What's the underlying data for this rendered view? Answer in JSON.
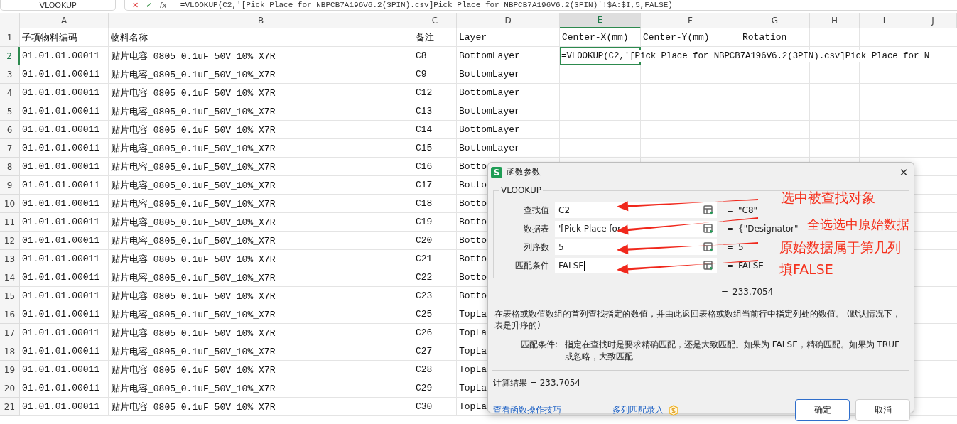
{
  "name_box": "VLOOKUP",
  "formula_bar": {
    "cancel": "✕",
    "confirm": "✓",
    "fx": "fx",
    "formula": "=VLOOKUP(C2,'[Pick Place for NBPCB7A196V6.2(3PIN).csv]Pick Place for NBPCB7A196V6.2(3PIN)'!$A:$I,5,FALSE)"
  },
  "columns": [
    {
      "label": "A",
      "selected": false
    },
    {
      "label": "B",
      "selected": false
    },
    {
      "label": "C",
      "selected": false
    },
    {
      "label": "D",
      "selected": false
    },
    {
      "label": "E",
      "selected": true
    },
    {
      "label": "F",
      "selected": false
    },
    {
      "label": "G",
      "selected": false
    },
    {
      "label": "H",
      "selected": false
    },
    {
      "label": "I",
      "selected": false
    },
    {
      "label": "J",
      "selected": false
    }
  ],
  "rows": [
    {
      "number": "1",
      "selected": false,
      "cells": [
        "子项物料编码",
        "物料名称",
        "备注",
        "Layer",
        "Center-X(mm)",
        "Center-Y(mm)",
        "Rotation"
      ]
    },
    {
      "number": "2",
      "selected": true,
      "cells": [
        "01.01.01.00011",
        "贴片电容_0805_0.1uF_50V_10%_X7R",
        "C8",
        "BottomLayer",
        "=VLOOKUP(C2,'[Pick Place for NBPCB7A196V6.2(3PIN).csv]Pick Place for N"
      ]
    },
    {
      "number": "3",
      "selected": false,
      "cells": [
        "01.01.01.00011",
        "贴片电容_0805_0.1uF_50V_10%_X7R",
        "C9",
        "BottomLayer"
      ]
    },
    {
      "number": "4",
      "selected": false,
      "cells": [
        "01.01.01.00011",
        "贴片电容_0805_0.1uF_50V_10%_X7R",
        "C12",
        "BottomLayer"
      ]
    },
    {
      "number": "5",
      "selected": false,
      "cells": [
        "01.01.01.00011",
        "贴片电容_0805_0.1uF_50V_10%_X7R",
        "C13",
        "BottomLayer"
      ]
    },
    {
      "number": "6",
      "selected": false,
      "cells": [
        "01.01.01.00011",
        "贴片电容_0805_0.1uF_50V_10%_X7R",
        "C14",
        "BottomLayer"
      ]
    },
    {
      "number": "7",
      "selected": false,
      "cells": [
        "01.01.01.00011",
        "贴片电容_0805_0.1uF_50V_10%_X7R",
        "C15",
        "BottomLayer"
      ]
    },
    {
      "number": "8",
      "selected": false,
      "cells": [
        "01.01.01.00011",
        "贴片电容_0805_0.1uF_50V_10%_X7R",
        "C16",
        "Botto"
      ]
    },
    {
      "number": "9",
      "selected": false,
      "cells": [
        "01.01.01.00011",
        "贴片电容_0805_0.1uF_50V_10%_X7R",
        "C17",
        "Botto"
      ]
    },
    {
      "number": "10",
      "selected": false,
      "cells": [
        "01.01.01.00011",
        "贴片电容_0805_0.1uF_50V_10%_X7R",
        "C18",
        "Botto"
      ]
    },
    {
      "number": "11",
      "selected": false,
      "cells": [
        "01.01.01.00011",
        "贴片电容_0805_0.1uF_50V_10%_X7R",
        "C19",
        "Botto"
      ]
    },
    {
      "number": "12",
      "selected": false,
      "cells": [
        "01.01.01.00011",
        "贴片电容_0805_0.1uF_50V_10%_X7R",
        "C20",
        "Botto"
      ]
    },
    {
      "number": "13",
      "selected": false,
      "cells": [
        "01.01.01.00011",
        "贴片电容_0805_0.1uF_50V_10%_X7R",
        "C21",
        "Botto"
      ]
    },
    {
      "number": "14",
      "selected": false,
      "cells": [
        "01.01.01.00011",
        "贴片电容_0805_0.1uF_50V_10%_X7R",
        "C22",
        "Botto"
      ]
    },
    {
      "number": "15",
      "selected": false,
      "cells": [
        "01.01.01.00011",
        "贴片电容_0805_0.1uF_50V_10%_X7R",
        "C23",
        "Botto"
      ]
    },
    {
      "number": "16",
      "selected": false,
      "cells": [
        "01.01.01.00011",
        "贴片电容_0805_0.1uF_50V_10%_X7R",
        "C25",
        "TopLa"
      ]
    },
    {
      "number": "17",
      "selected": false,
      "cells": [
        "01.01.01.00011",
        "贴片电容_0805_0.1uF_50V_10%_X7R",
        "C26",
        "TopLa"
      ]
    },
    {
      "number": "18",
      "selected": false,
      "cells": [
        "01.01.01.00011",
        "贴片电容_0805_0.1uF_50V_10%_X7R",
        "C27",
        "TopLa"
      ]
    },
    {
      "number": "19",
      "selected": false,
      "cells": [
        "01.01.01.00011",
        "贴片电容_0805_0.1uF_50V_10%_X7R",
        "C28",
        "TopLa"
      ]
    },
    {
      "number": "20",
      "selected": false,
      "cells": [
        "01.01.01.00011",
        "贴片电容_0805_0.1uF_50V_10%_X7R",
        "C29",
        "TopLa"
      ]
    },
    {
      "number": "21",
      "selected": false,
      "cells": [
        "01.01.01.00011",
        "贴片电容_0805_0.1uF_50V_10%_X7R",
        "C30",
        "TopLa"
      ]
    }
  ],
  "dialog": {
    "icon_letter": "S",
    "title": "函数参数",
    "close": "✕",
    "function_name": "VLOOKUP",
    "arguments": [
      {
        "label": "查找值",
        "value": "C2",
        "result": "\"C8\""
      },
      {
        "label": "数据表",
        "value": "'[Pick Place for",
        "result": "{\"Designator\""
      },
      {
        "label": "列序数",
        "value": "5",
        "result": "5"
      },
      {
        "label": "匹配条件",
        "value": "FALSE",
        "result": "FALSE"
      }
    ],
    "equals": "=",
    "result": "233.7054",
    "description": "在表格或数值数组的首列查找指定的数值，并由此返回表格或数组当前行中指定列处的数值。 (默认情况下，表是升序的)",
    "param_name": "匹配条件:",
    "param_description": "指定在查找时是要求精确匹配，还是大致匹配。如果为 FALSE，精确匹配。如果为 TRUE 或忽略，大致匹配",
    "computed": "计算结果 = 233.7054",
    "links": [
      "查看函数操作技巧",
      "多列匹配录入"
    ],
    "buttons": [
      {
        "label": "确定",
        "primary": true
      },
      {
        "label": "取消",
        "primary": false
      }
    ]
  },
  "annotations": [
    {
      "text": "选中被查找对象"
    },
    {
      "text": "全选选中原始数据"
    },
    {
      "text": "原始数据属于第几列"
    },
    {
      "text": "填FALSE"
    }
  ]
}
